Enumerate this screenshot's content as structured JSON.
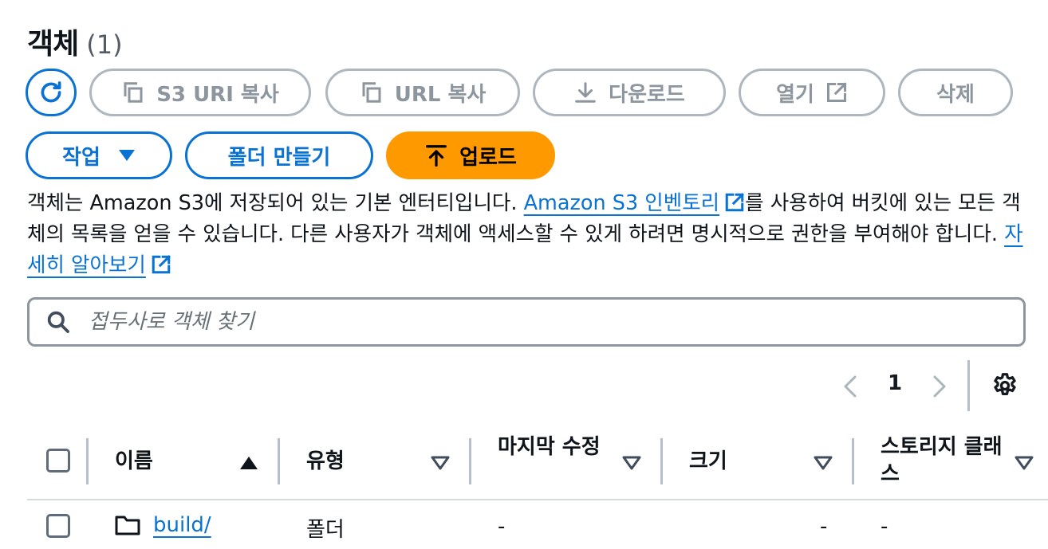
{
  "header": {
    "title": "객체",
    "count": "(1)"
  },
  "toolbar": {
    "copy_s3_uri": "S3 URI 복사",
    "copy_url": "URL 복사",
    "download": "다운로드",
    "open": "열기",
    "delete": "삭제",
    "actions": "작업",
    "create_folder": "폴더 만들기",
    "upload": "업로드"
  },
  "description": {
    "part1": "객체는 Amazon S3에 저장되어 있는 기본 엔터티입니다. ",
    "link1": "Amazon S3 인벤토리",
    "part2": "를 사용하여 버킷에 있는 모든 객체의 목록을 얻을 수 있습니다. 다른 사용자가 객체에 액세스할 수 있게 하려면 명시적으로 권한을 부여해야 합니다. ",
    "link2": "자세히 알아보기"
  },
  "search": {
    "placeholder": "접두사로 객체 찾기"
  },
  "pagination": {
    "current_page": "1"
  },
  "table": {
    "columns": [
      {
        "label": "이름",
        "sort": "ascending"
      },
      {
        "label": "유형",
        "sort": "none"
      },
      {
        "label": "마지막 수정",
        "sort": "none"
      },
      {
        "label": "크기",
        "sort": "none"
      },
      {
        "label": "스토리지 클래스",
        "sort": "none"
      }
    ],
    "rows": [
      {
        "name": "build/",
        "type": "폴더",
        "last_modified": "-",
        "size": "-",
        "storage_class": "-"
      }
    ]
  },
  "colors": {
    "accent": "#0972d3",
    "upload": "#ff9900",
    "disabled": "#8d959e"
  }
}
